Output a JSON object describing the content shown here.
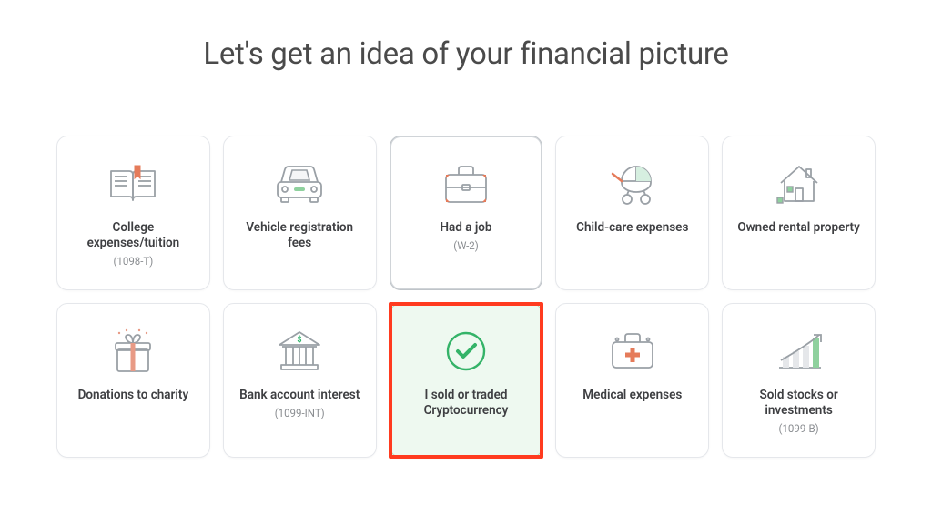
{
  "title": "Let's get an idea of your financial picture",
  "cards": [
    {
      "icon": "book",
      "label": "College expenses/tuition",
      "sub": "(1098-T)",
      "state": "default"
    },
    {
      "icon": "car",
      "label": "Vehicle registration fees",
      "sub": "",
      "state": "default"
    },
    {
      "icon": "briefcase",
      "label": "Had a job",
      "sub": "(W-2)",
      "state": "hover"
    },
    {
      "icon": "stroller",
      "label": "Child-care expenses",
      "sub": "",
      "state": "default"
    },
    {
      "icon": "house",
      "label": "Owned rental property",
      "sub": "",
      "state": "default"
    },
    {
      "icon": "gift",
      "label": "Donations to charity",
      "sub": "",
      "state": "default"
    },
    {
      "icon": "bank",
      "label": "Bank account interest",
      "sub": "(1099-INT)",
      "state": "default"
    },
    {
      "icon": "check",
      "label": "I sold or traded Cryptocurrency",
      "sub": "",
      "state": "selected-highlighted"
    },
    {
      "icon": "medkit",
      "label": "Medical expenses",
      "sub": "",
      "state": "default"
    },
    {
      "icon": "chart",
      "label": "Sold stocks or investments",
      "sub": "(1099-B)",
      "state": "default"
    }
  ],
  "colors": {
    "stroke": "#9aa0a6",
    "accentGreen": "#2fb36a",
    "accentOrange": "#e57b5a",
    "checkGreen": "#34b368",
    "highlight": "#ff3b1f"
  }
}
